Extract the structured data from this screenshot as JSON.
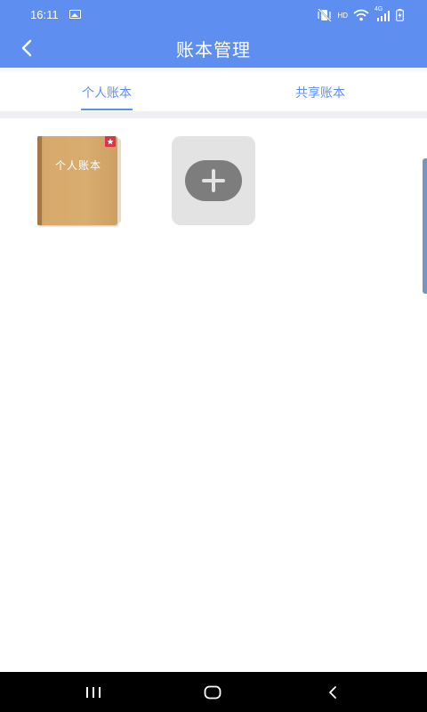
{
  "status_bar": {
    "time": "16:11",
    "hd_label": "HD",
    "network_label": "4G"
  },
  "header": {
    "title": "账本管理",
    "back_icon": "chevron-left-icon"
  },
  "tabs": [
    {
      "label": "个人账本",
      "selected": true
    },
    {
      "label": "共享账本",
      "selected": false
    }
  ],
  "ledgers": [
    {
      "name": "个人账本",
      "icon": "book-icon",
      "badge_icon": "star-icon"
    }
  ],
  "add_ledger": {
    "icon": "plus-icon"
  },
  "nav_bar": {
    "buttons": [
      "recent-apps-icon",
      "home-icon",
      "back-icon"
    ]
  },
  "colors": {
    "primary": "#5e8ff0",
    "background": "#ffffff",
    "divider": "#eeeff3",
    "add_card": "#e3e3e3",
    "add_circle": "#7d7d7d",
    "bookmark": "#d9344a",
    "nav_bar": "#000000"
  }
}
